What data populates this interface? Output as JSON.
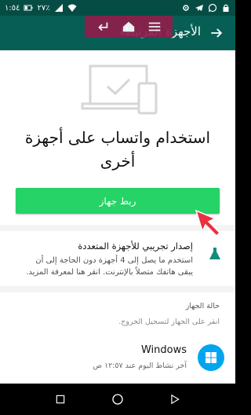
{
  "status_bar": {
    "time": "١:٥٤",
    "battery": "٢٧٪",
    "icons": [
      "battery-icon",
      "signal-icon",
      "wifi-icon",
      "settings-icon",
      "telegram-icon",
      "whatsapp-icon",
      "lock-icon"
    ]
  },
  "app_bar": {
    "title": "الأجهزة المرتبطة",
    "back_icon": "arrow-back-icon"
  },
  "nav_overlay": {
    "icons": [
      "enter-icon",
      "home-icon",
      "menu-icon"
    ]
  },
  "hero": {
    "illustration": "linked-devices-illustration",
    "title": "استخدام واتساب على أجهزة أخرى",
    "button_label": "ربط جهاز"
  },
  "beta": {
    "icon": "flask-icon",
    "title": "إصدار تجريبي للأجهزة المتعددة",
    "description": "استخدم ما يصل إلى 4 أجهزة دون الحاجة إلى أن يبقى هاتفك متصلاً بالإنترنت. انقر هنا لمعرفة المزيد."
  },
  "device_status": {
    "heading": "حالة الجهاز",
    "hint": "انقر على الجهاز لتسجيل الخروج.",
    "devices": [
      {
        "name": "Windows",
        "last_active": "آخر نشاط اليوم عند ١٢:٥٧ ص",
        "icon": "windows-icon"
      }
    ]
  },
  "colors": {
    "header": "#075e54",
    "status_bar": "#054d44",
    "accent_green": "#25d366",
    "beta_icon": "#128c7e",
    "cursor": "#e8323f",
    "windows_badge": "#00a5f0"
  },
  "bottom_nav": [
    "square-icon",
    "circle-icon",
    "triangle-icon"
  ]
}
